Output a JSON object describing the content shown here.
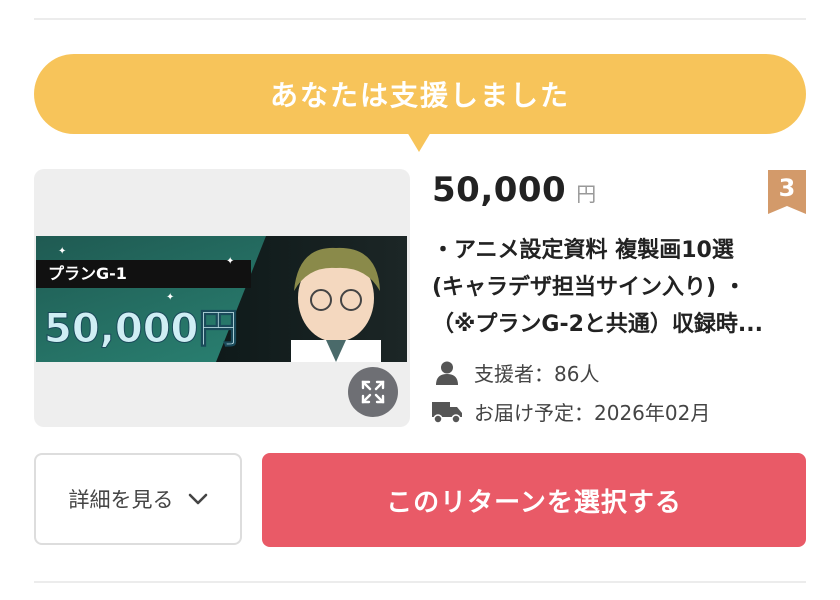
{
  "banner": {
    "text": "あなたは支援しました"
  },
  "reward": {
    "image": {
      "plan_label": "プランG-1",
      "price_label": "50,000円"
    },
    "price": "50,000",
    "currency": "円",
    "rank": "3",
    "description_lines": [
      "・アニメ設定資料 複製画10選",
      "(キャラデザ担当サイン入り) ・",
      "（※プランG-2と共通）収録時..."
    ],
    "supporters": "支援者：86人",
    "delivery": "お届け予定：2026年02月"
  },
  "buttons": {
    "details": "詳細を見る",
    "select": "このリターンを選択する"
  },
  "colors": {
    "banner": "#f7c45a",
    "select_button": "#e95a67",
    "rank_badge": "#d39a6a"
  }
}
